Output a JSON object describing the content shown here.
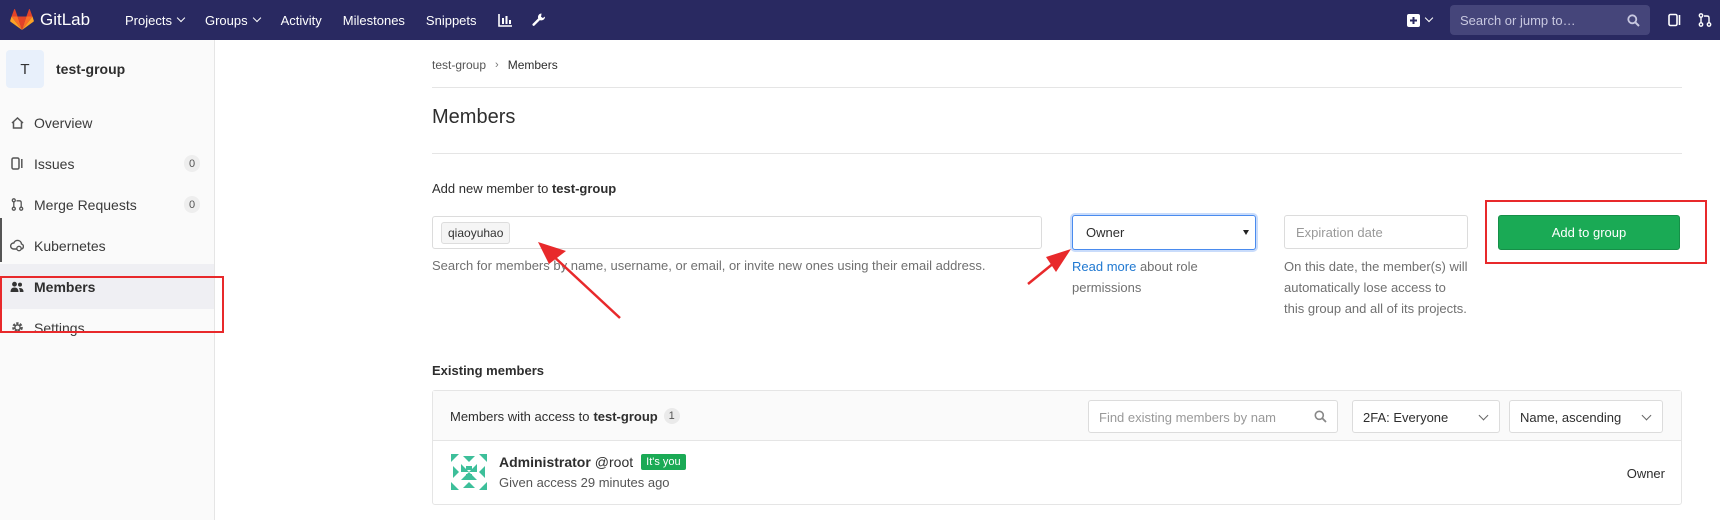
{
  "topnav": {
    "brand": "GitLab",
    "links": [
      "Projects",
      "Groups",
      "Activity",
      "Milestones",
      "Snippets"
    ],
    "search_placeholder": "Search or jump to…"
  },
  "sidebar": {
    "group_initial": "T",
    "group_name": "test-group",
    "items": [
      {
        "label": "Overview",
        "icon": "home-icon"
      },
      {
        "label": "Issues",
        "icon": "issues-icon",
        "badge": "0"
      },
      {
        "label": "Merge Requests",
        "icon": "merge-request-icon",
        "badge": "0"
      },
      {
        "label": "Kubernetes",
        "icon": "cloud-gear-icon"
      },
      {
        "label": "Members",
        "icon": "users-icon",
        "active": true
      },
      {
        "label": "Settings",
        "icon": "gear-icon"
      }
    ]
  },
  "breadcrumb": {
    "group": "test-group",
    "current": "Members"
  },
  "page_title": "Members",
  "add_member": {
    "label_prefix": "Add new member to",
    "group": "test-group",
    "selected_user": "qiaoyuhao",
    "helper": "Search for members by name, username, or email, or invite new ones using their email address.",
    "role": "Owner",
    "role_link": "Read more",
    "role_help": "about role permissions",
    "expiration_placeholder": "Expiration date",
    "expiration_help": "On this date, the member(s) will automatically lose access to this group and all of its projects.",
    "submit": "Add to group"
  },
  "existing": {
    "label": "Existing members",
    "header_prefix": "Members with access to",
    "group": "test-group",
    "count": "1",
    "find_placeholder": "Find existing members by nam",
    "filter_2fa": "2FA: Everyone",
    "sort": "Name, ascending",
    "members": [
      {
        "name": "Administrator",
        "username": "@root",
        "badge": "It's you",
        "access": "Given access 29 minutes ago",
        "role": "Owner"
      }
    ]
  },
  "colors": {
    "nav": "#292961",
    "accent_green": "#1aaa55",
    "annotation_red": "#e8292b",
    "link_blue": "#1f78d1"
  }
}
